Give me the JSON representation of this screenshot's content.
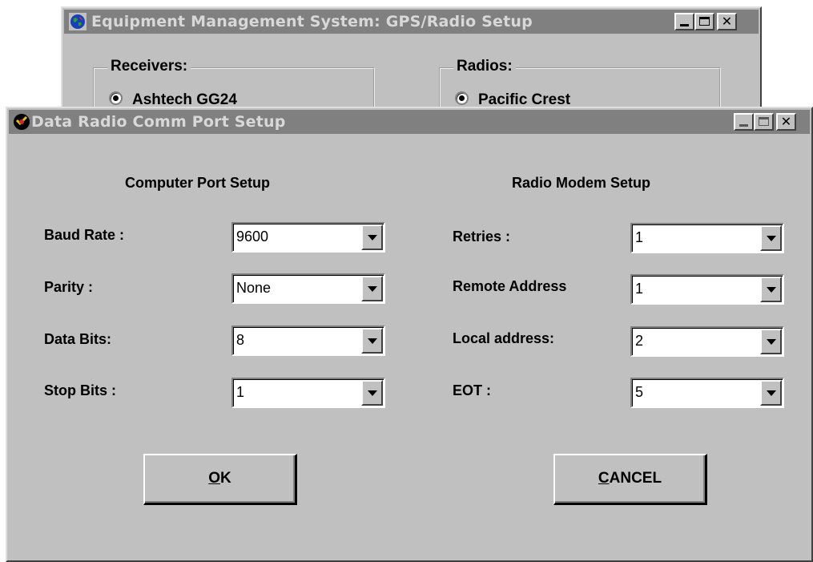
{
  "background_window": {
    "title": "Equipment Management System: GPS/Radio Setup",
    "receivers_group": {
      "label": "Receivers:",
      "selected": "Ashtech GG24"
    },
    "radios_group": {
      "label": "Radios:",
      "selected": "Pacific Crest"
    }
  },
  "dialog": {
    "title": "Data Radio Comm Port Setup",
    "computer_port": {
      "heading": "Computer Port Setup",
      "fields": [
        {
          "label": "Baud Rate :",
          "value": "9600"
        },
        {
          "label": "Parity :",
          "value": "None"
        },
        {
          "label": "Data Bits:",
          "value": "8"
        },
        {
          "label": "Stop Bits :",
          "value": "1"
        }
      ]
    },
    "radio_modem": {
      "heading": "Radio Modem Setup",
      "fields": [
        {
          "label": "Retries :",
          "value": "1"
        },
        {
          "label": "Remote Address",
          "value": "1"
        },
        {
          "label": "Local address:",
          "value": "2"
        },
        {
          "label": "EOT :",
          "value": "5"
        }
      ]
    },
    "ok_button": {
      "mnemonic": "O",
      "rest": "K"
    },
    "cancel_button": {
      "mnemonic": "C",
      "rest": "ANCEL"
    }
  },
  "icons": {
    "background_app_icon": "globe-icon",
    "dialog_app_icon": "radio-icon",
    "minimize": "minimize-icon",
    "maximize": "maximize-icon",
    "close": "close-icon",
    "dropdown": "chevron-down-icon"
  }
}
